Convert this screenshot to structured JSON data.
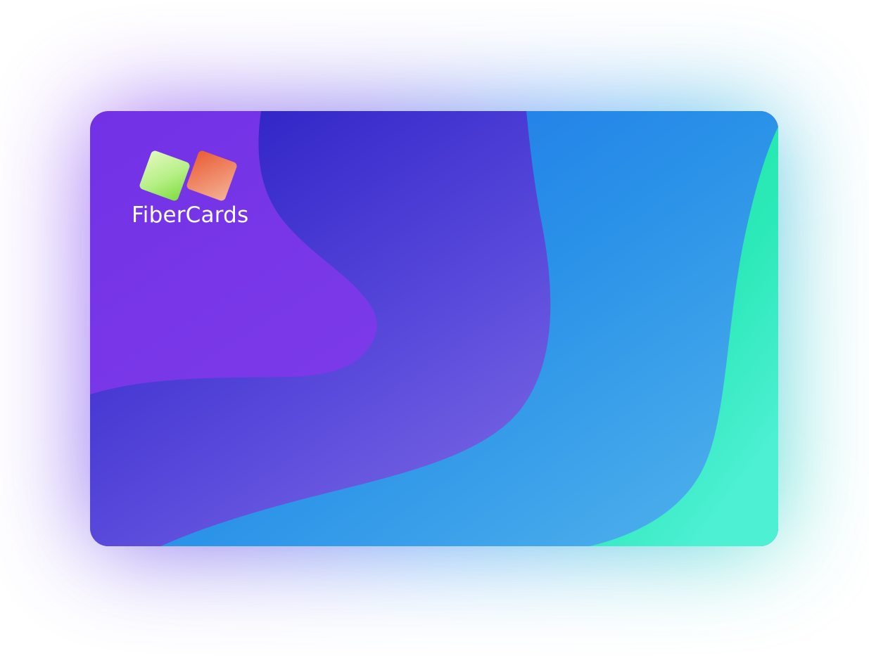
{
  "card": {
    "brand_name": "FiberCards",
    "logo_icon": "two-tilted-squares-logo-icon",
    "colors": {
      "purple": "#7b38e8",
      "indigo": "#3a2ccb",
      "violet": "#7a66e2",
      "blue": "#1f74e8",
      "sky": "#4aaeea",
      "mint": "#1ae99c",
      "logo_green_light": "#d6f7b0",
      "logo_green": "#8ae24e",
      "logo_orange": "#ec6a42",
      "logo_peach": "#f2a482"
    }
  }
}
